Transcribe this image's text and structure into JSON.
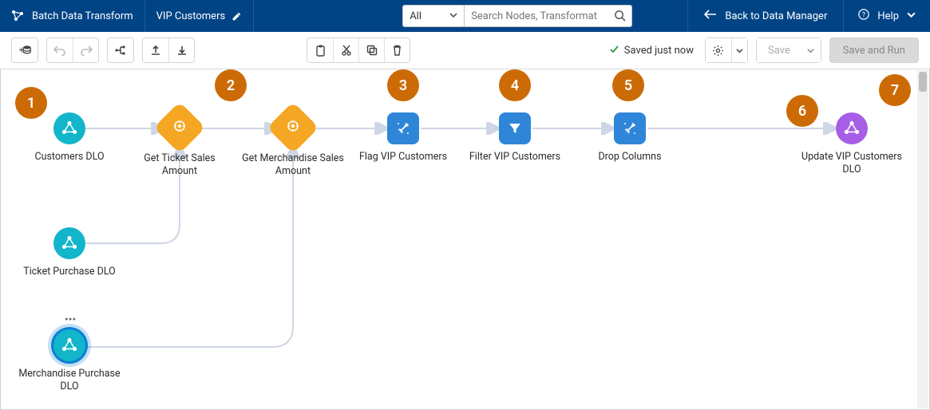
{
  "header": {
    "app_title": "Batch Data Transform",
    "tab_title": "VIP Customers",
    "search_filter_label": "All",
    "search_placeholder": "Search Nodes, Transformat",
    "back_label": "Back to Data Manager",
    "help_label": "Help"
  },
  "toolbar": {
    "saved_status": "Saved just now",
    "save_label": "Save",
    "save_run_label": "Save and Run"
  },
  "nodes": {
    "n0": {
      "label": "Customers DLO"
    },
    "n1": {
      "label": "Get Ticket Sales Amount"
    },
    "n2": {
      "label": "Get Merchandise Sales Amount"
    },
    "n3": {
      "label": "Flag VIP Customers"
    },
    "n4": {
      "label": "Filter VIP Customers"
    },
    "n5": {
      "label": "Drop Columns"
    },
    "n6": {
      "label": "Update VIP Customers DLO"
    },
    "s1": {
      "label": "Ticket Purchase DLO"
    },
    "s2": {
      "label": "Merchandise Purchase DLO"
    }
  },
  "callouts": {
    "c1": "1",
    "c2": "2",
    "c3": "3",
    "c4": "4",
    "c5": "5",
    "c6": "6",
    "c7": "7"
  }
}
